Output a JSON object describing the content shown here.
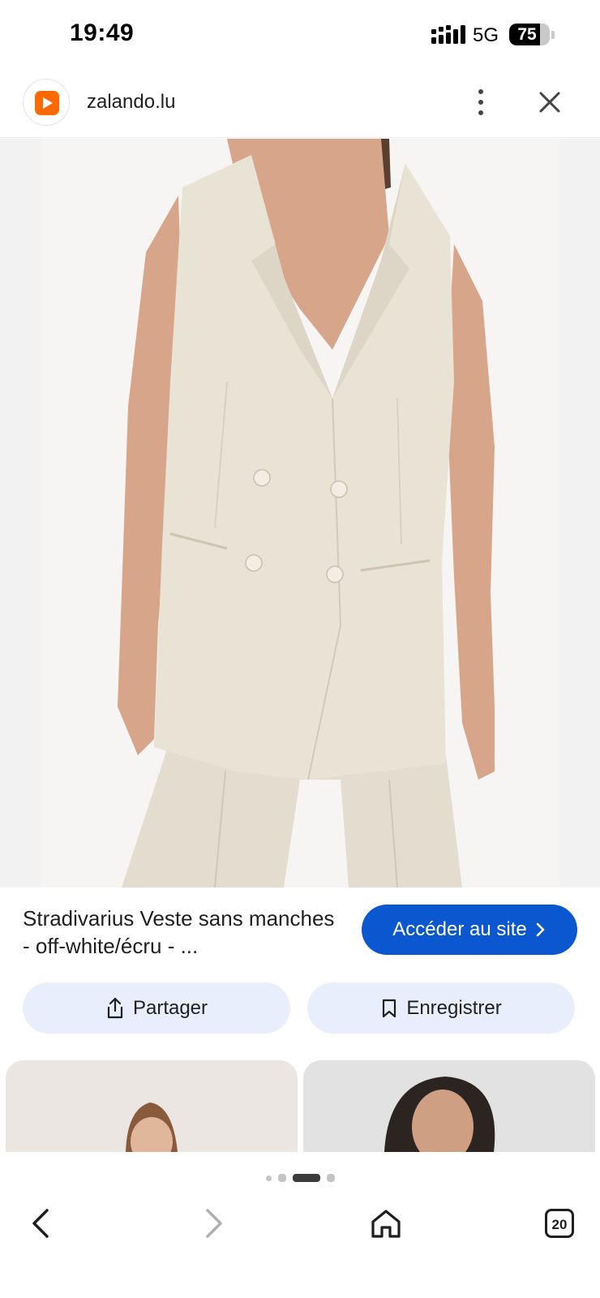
{
  "status_bar": {
    "time": "19:49",
    "network": "5G",
    "battery_level": "75",
    "battery_fraction": 0.75
  },
  "header": {
    "domain": "zalando.lu",
    "favicon_color": "#ff6900",
    "menu_icon": "more-vertical-icon",
    "close_icon": "close-icon"
  },
  "product": {
    "title": "Stradivarius Veste sans manches - off-white/écru - ...",
    "visit_label": "Accéder au site",
    "visit_color": "#0b57d0",
    "garment_color": "#e9e3d6"
  },
  "actions": {
    "share_label": "Partager",
    "share_icon": "share-icon",
    "save_label": "Enregistrer",
    "save_icon": "bookmark-icon",
    "button_bg": "#e8eefb"
  },
  "pager": {
    "count": 4,
    "active_index": 2
  },
  "bottom_nav": {
    "back_icon": "back-arrow-icon",
    "forward_icon": "forward-arrow-icon",
    "home_icon": "home-icon",
    "tabs_count": "20"
  }
}
